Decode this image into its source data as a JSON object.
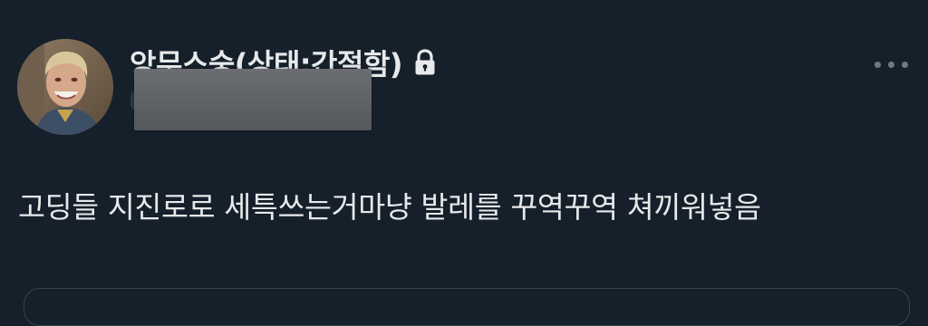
{
  "tweet": {
    "display_name": "앙무스숭(상태:간절함)",
    "avatar_icon": "person-avatar-icon",
    "lock_icon": "lock-icon",
    "more_icon": "more-horizontal-icon",
    "text": "고딩들 지진로로 세특쓰는거마냥 발레를 꾸역꾸역 쳐끼워넣음"
  },
  "colors": {
    "background": "#15202b",
    "text": "#e7e9ea",
    "redaction": "#5d6065",
    "icon_muted": "#6e7a86"
  }
}
